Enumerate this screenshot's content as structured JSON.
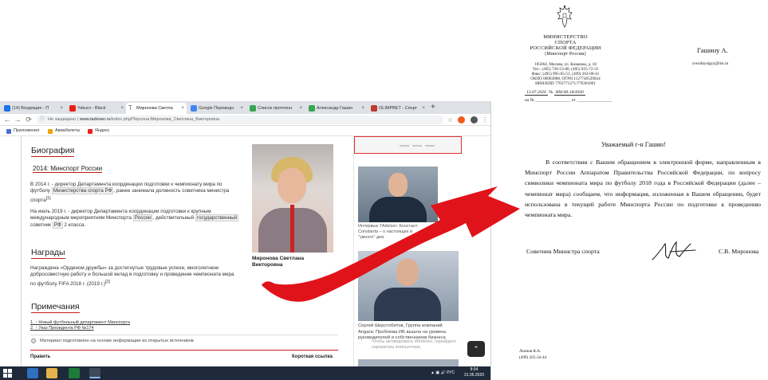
{
  "browser": {
    "tabs": [
      {
        "label": "(14) Входящие - П",
        "color": "#1a73e8"
      },
      {
        "label": "Yakuro - Black",
        "color": "#e62117"
      },
      {
        "label": "Миронова Светла",
        "color": "#666666",
        "active": true
      },
      {
        "label": "Google Переводч",
        "color": "#4285f4"
      },
      {
        "label": "Список прочтенн",
        "color": "#34a853"
      },
      {
        "label": "Александр Гашин",
        "color": "#34a853"
      },
      {
        "label": "OLIMPBET - Спорт",
        "color": "#c0392b"
      }
    ],
    "new_tab": "+",
    "address": {
      "not_secure": "Не защищено",
      "separator": " | ",
      "domain": "www.tadviser.ru",
      "path": "/index.php/Персона:Миронова_Светлана_Викторовна"
    },
    "bookmarks": [
      {
        "label": "Приложения",
        "color": "#4a6fd8"
      },
      {
        "label": "Авиабилеты",
        "color": "#f0a500"
      },
      {
        "label": "Яндекс",
        "color": "#e22"
      }
    ],
    "nav": {
      "back": "←",
      "forward": "→",
      "reload": "⟳"
    }
  },
  "article": {
    "bio_heading": "Биография",
    "minsport_heading": "2014: Минспорт России",
    "bio_p1": {
      "a": "В 2014 г. - директор Департамента координации подготовки к чемпионату мира по футболу",
      "link": "Министерства спорта РФ",
      "b": ", ранее занимала должность советника министра спорта",
      "ref": "[1]"
    },
    "bio_p2": {
      "a": "На июль 2019 г. - директор Департамента координации подготовки к крупным международным мероприятиям Минспорта",
      "link1": "России",
      "b": ", действительный",
      "link2": "государственный",
      "c": "советник",
      "link3": "РФ",
      "d": "2 класса."
    },
    "awards_heading": "Награды",
    "awards_p": "Награждена «Орденом дружбы» за достигнутые трудовые успехи, многолетнюю добросовестную работу и большой вклад в подготовку и проведение чемпионата мира по футболу FIFA 2018 г. (2019 г.)",
    "awards_ref": "[2]",
    "notes_heading": "Примечания",
    "notes": [
      "1. ↑ Новый футбольный департамент Минспорта",
      "2. ↑ Указ Президента РФ №174"
    ],
    "footer_note": "Материал подготовлен на основе информации из открытых источников",
    "edit": "Править",
    "short_link": "Короткая ссылка"
  },
  "sidebar": {
    "portrait_caption": [
      "Миронова Светлана",
      "Викторовна"
    ],
    "caption2": [
      "Интервью TAdviser: Констант",
      "Constanta – о настоящих и",
      "\"умного\" дев"
    ],
    "caption3": [
      "Сергей Шерстобитов, Группа компаний",
      "Angara: Проблема ИБ вышла на уровень",
      "руководителей и собственников бизнеса"
    ],
    "watermark": [
      "Чтобы активировать Windows, перейдите",
      "параметры компьютера."
    ],
    "scroll_up": "⌃"
  },
  "taskbar": {
    "tray": "▲  ▣  🔊  РУС",
    "time": "8:04",
    "date": "31.05.2020"
  },
  "letter": {
    "ministry": [
      "МИНИСТЕРСТВО",
      "СПОРТА",
      "РОССИЙСКОЙ ФЕДЕРАЦИИ",
      "(Минспорт России)"
    ],
    "address": [
      "105064, Москва, ул. Казакова, д. 18",
      "Тел.: (495) 720-53-80, (495) 925-72-31",
      "Факс: (495) 995-05-51, (499) 263-08-41",
      "ОКПО 00083888, ОГРН 1127746520824",
      "ИНН/КПП 7703771271/770301001"
    ],
    "date_hand": "13.07.2020",
    "num_prefix_on": "на №",
    "num_label": "№",
    "num_hand": "ВМ-08-18/4030",
    "num_line2_a": "на № ________________ от ________________",
    "recipient": "Гашину А.",
    "recipient_email": "zvezdnysigry@list.ru",
    "greeting": "Уважаемый г-н Гашин!",
    "body": "В соответствии с Вашим обращением в электронной форме, направленным в Минспорт России Аппаратом Правительства Российской Федерации, по вопросу символики чемпионата мира по футболу 2018 года в Российской Федерации (далее – чемпионат мира) сообщаем, что информация, изложенная в Вашем обращении, будет использована в текущей работе Минспорта России по подготовке к проведению чемпионата мира.",
    "signer_position": "Советник Министра спорта",
    "signer_name": "С.В. Миронова",
    "executor_name": "Леонов К.А.",
    "executor_phone": "(499) 265-34-44"
  },
  "colors": {
    "accent_red": "#c51a1a",
    "arrow_red": "#e0131a"
  }
}
